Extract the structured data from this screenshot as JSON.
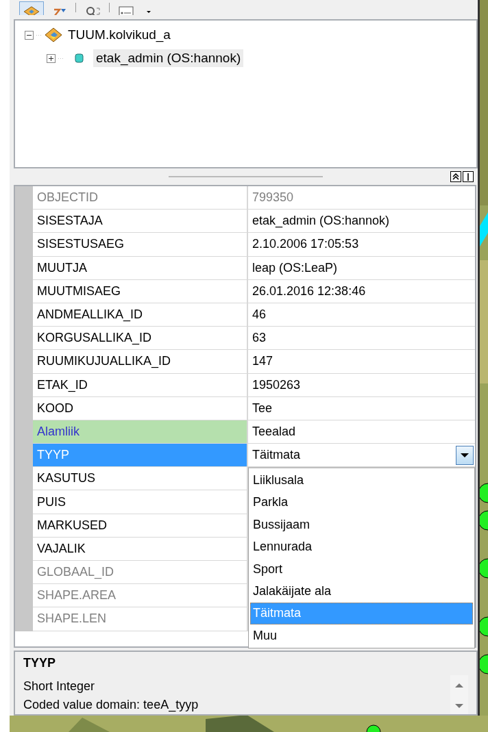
{
  "toolbar": {
    "buttons": [
      {
        "kind": "layers",
        "selected": true
      },
      {
        "kind": "sort",
        "selected": false
      },
      {
        "kind": "zoom",
        "selected": false
      },
      {
        "kind": "form",
        "selected": false
      },
      {
        "kind": "caret",
        "selected": false
      }
    ]
  },
  "tree": [
    {
      "label": "TUUM.kolvikud_a",
      "kind": "featureclass",
      "expanded": true,
      "selected": false,
      "children": [
        {
          "label": "etak_admin (OS:hannok)",
          "kind": "feature",
          "expanded": false,
          "selected": true
        }
      ]
    }
  ],
  "attributes": [
    {
      "name": "OBJECTID",
      "value": "799350",
      "kind": "field",
      "disabled": true,
      "selected": false
    },
    {
      "name": "SISESTAJA",
      "value": "etak_admin (OS:hannok)",
      "kind": "field",
      "disabled": false,
      "selected": false
    },
    {
      "name": "SISESTUSAEG",
      "value": "2.10.2006 17:05:53",
      "kind": "field",
      "disabled": false,
      "selected": false
    },
    {
      "name": "MUUTJA",
      "value": "leap (OS:LeaP)",
      "kind": "field",
      "disabled": false,
      "selected": false
    },
    {
      "name": "MUUTMISAEG",
      "value": "26.01.2016 12:38:46",
      "kind": "field",
      "disabled": false,
      "selected": false
    },
    {
      "name": "ANDMEALLIKA_ID",
      "value": "46",
      "kind": "field",
      "disabled": false,
      "selected": false
    },
    {
      "name": "KORGUSALLIKA_ID",
      "value": "63",
      "kind": "field",
      "disabled": false,
      "selected": false
    },
    {
      "name": "RUUMIKUJUALLIKA_ID",
      "value": "147",
      "kind": "field",
      "disabled": false,
      "selected": false
    },
    {
      "name": "ETAK_ID",
      "value": "1950263",
      "kind": "field",
      "disabled": false,
      "selected": false
    },
    {
      "name": "KOOD",
      "value": "Tee",
      "kind": "field",
      "disabled": false,
      "selected": false
    },
    {
      "name": "Alamliik",
      "value": "Teealad",
      "kind": "subtype",
      "disabled": false,
      "selected": false
    },
    {
      "name": "TYYP",
      "value": "Täitmata",
      "kind": "field",
      "disabled": false,
      "selected": true
    },
    {
      "name": "KASUTUS",
      "kind": "field",
      "disabled": false,
      "selected": false
    },
    {
      "name": "PUIS",
      "kind": "field",
      "disabled": false,
      "selected": false
    },
    {
      "name": "MARKUSED",
      "kind": "field",
      "disabled": false,
      "selected": false
    },
    {
      "name": "VAJALIK",
      "kind": "field",
      "disabled": false,
      "selected": false
    },
    {
      "name": "GLOBAAL_ID",
      "kind": "field",
      "disabled": true,
      "selected": false
    },
    {
      "name": "SHAPE.AREA",
      "kind": "field",
      "disabled": true,
      "selected": false
    },
    {
      "name": "SHAPE.LEN",
      "kind": "field",
      "disabled": true,
      "selected": false
    }
  ],
  "dropdown": {
    "options": [
      {
        "label": "Liiklusala",
        "selected": false
      },
      {
        "label": "Parkla",
        "selected": false
      },
      {
        "label": "Bussijaam",
        "selected": false
      },
      {
        "label": "Lennurada",
        "selected": false
      },
      {
        "label": "Sport",
        "selected": false
      },
      {
        "label": "Jalakäijate ala",
        "selected": false
      },
      {
        "label": "Täitmata",
        "selected": true
      },
      {
        "label": "Muu",
        "selected": false
      }
    ]
  },
  "description": {
    "title": "TYYP",
    "lines": [
      "Short Integer",
      "Coded value domain: teeA_tyyp"
    ]
  }
}
